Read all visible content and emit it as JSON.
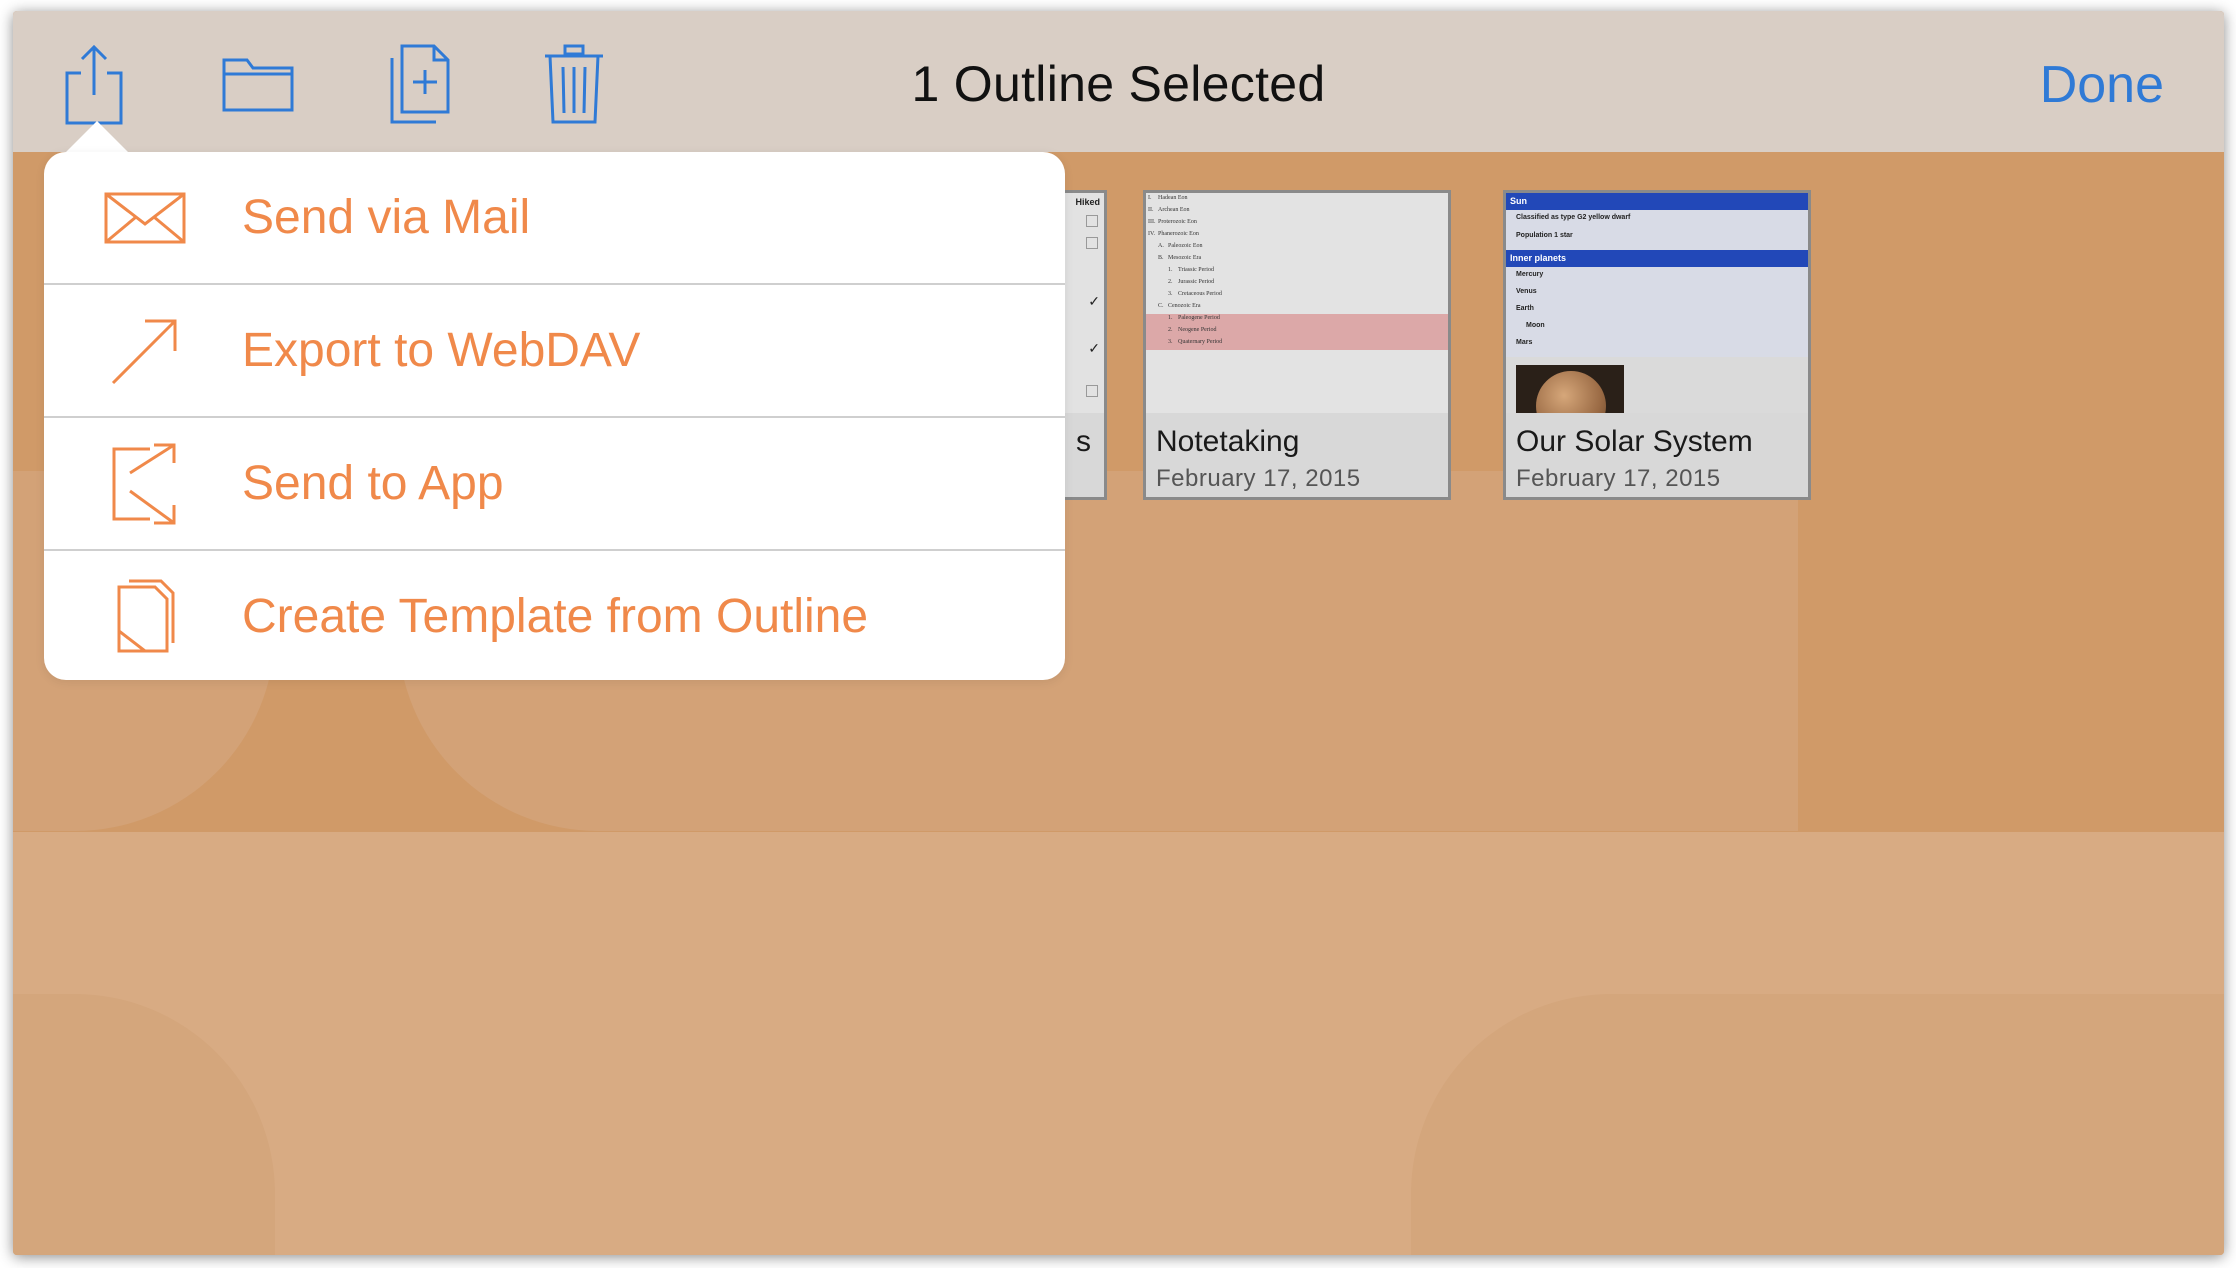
{
  "toolbar": {
    "title": "1 Outline Selected",
    "done_label": "Done",
    "icons": [
      "share-icon",
      "folder-icon",
      "duplicate-icon",
      "trash-icon"
    ]
  },
  "documents": [
    {
      "name": "Notetaking",
      "date": "February 17, 2015"
    },
    {
      "name": "Our Solar System",
      "date": "February 17, 2015"
    }
  ],
  "partial_document": {
    "name_fragment": "s",
    "header": "Hiked"
  },
  "notetaking_thumb": {
    "lines": [
      "I.",
      "Hadean Eon",
      "II.",
      "Archean Eon",
      "III.",
      "Proterozoic Eon",
      "IV.",
      "Phanerozoic Eon",
      "A.",
      "Paleozoic Eon",
      "B.",
      "Mesozoic Era",
      "1.",
      "Triassic Period",
      "2.",
      "Jurassic Period",
      "3.",
      "Cretaceous Period",
      "C.",
      "Cenozoic Era",
      "1.",
      "Paleogene Period",
      "2.",
      "Neogene Period",
      "3.",
      "Quaternary Period"
    ]
  },
  "solar_thumb": {
    "header1": "Sun",
    "rows1": [
      "Classified as type G2 yellow dwarf",
      "Population 1 star"
    ],
    "header2": "Inner planets",
    "rows2": [
      "Mercury",
      "Venus",
      "Earth",
      "Moon",
      "Mars"
    ]
  },
  "share_menu": {
    "items": [
      {
        "label": "Send via Mail",
        "icon": "mail-icon"
      },
      {
        "label": "Export to WebDAV",
        "icon": "export-arrow-icon"
      },
      {
        "label": "Send to App",
        "icon": "send-to-app-icon"
      },
      {
        "label": "Create Template from Outline",
        "icon": "template-icon"
      }
    ]
  },
  "colors": {
    "accent_blue": "#2f7ad6",
    "menu_orange": "#f0894a",
    "background": "#d09a68",
    "toolbar": "#d9cec5"
  }
}
